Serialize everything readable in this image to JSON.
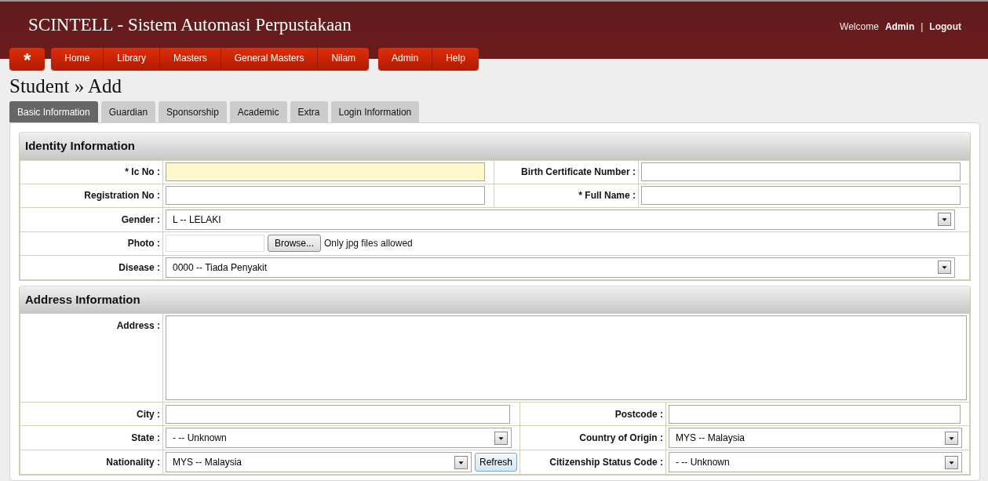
{
  "header": {
    "title": "SCINTELL - Sistem Automasi Perpustakaan",
    "welcome": "Welcome",
    "user": "Admin",
    "separator": "|",
    "logout": "Logout"
  },
  "menu_groups": [
    {
      "items": [
        {
          "label": "*",
          "kind": "star"
        }
      ]
    },
    {
      "items": [
        {
          "label": "Home",
          "kind": "text"
        },
        {
          "label": "Library",
          "kind": "text"
        },
        {
          "label": "Masters",
          "kind": "text"
        },
        {
          "label": "General Masters",
          "kind": "text"
        },
        {
          "label": "Nilam",
          "kind": "text"
        }
      ]
    },
    {
      "items": [
        {
          "label": "Admin",
          "kind": "text"
        },
        {
          "label": "Help",
          "kind": "text"
        }
      ]
    }
  ],
  "page_title": "Student » Add",
  "tabs": [
    {
      "label": "Basic Information",
      "selected": true
    },
    {
      "label": "Guardian",
      "selected": false
    },
    {
      "label": "Sponsorship",
      "selected": false
    },
    {
      "label": "Academic",
      "selected": false
    },
    {
      "label": "Extra",
      "selected": false
    },
    {
      "label": "Login Information",
      "selected": false
    }
  ],
  "sections": [
    {
      "title": "Identity Information",
      "rows": [
        {
          "fields": [
            {
              "label": "* Ic No :",
              "kind": "text",
              "highlighted": true
            },
            {
              "label": "Birth Certificate Number :",
              "kind": "text",
              "highlighted": false
            }
          ]
        },
        {
          "fields": [
            {
              "label": "Registration No :",
              "kind": "text",
              "highlighted": false
            },
            {
              "label": "* Full Name :",
              "kind": "text",
              "highlighted": false
            }
          ]
        },
        {
          "fields": [
            {
              "label": "Gender :",
              "kind": "select",
              "value": "L -- LELAKI"
            }
          ]
        },
        {
          "fields": [
            {
              "label": "Photo :",
              "kind": "file",
              "button": "Browse...",
              "hint": "Only jpg files allowed"
            }
          ]
        },
        {
          "fields": [
            {
              "label": "Disease :",
              "kind": "select",
              "value": "0000 -- Tiada Penyakit"
            }
          ]
        }
      ]
    },
    {
      "title": "Address Information",
      "rows": [
        {
          "fields": [
            {
              "label": "Address :",
              "kind": "textarea"
            }
          ]
        },
        {
          "fields": [
            {
              "label": "City :",
              "kind": "text",
              "highlighted": false
            },
            {
              "label": "Postcode :",
              "kind": "text",
              "highlighted": false
            }
          ]
        },
        {
          "fields": [
            {
              "label": "State :",
              "kind": "select",
              "value": "- -- Unknown"
            },
            {
              "label": "Country of Origin :",
              "kind": "select",
              "value": "MYS -- Malaysia"
            }
          ]
        },
        {
          "fields": [
            {
              "label": "Nationality :",
              "kind": "select",
              "value": "MYS -- Malaysia",
              "button": "Refresh"
            },
            {
              "label": "Citizenship Status Code :",
              "kind": "select",
              "value": "- -- Unknown"
            }
          ]
        }
      ]
    }
  ]
}
